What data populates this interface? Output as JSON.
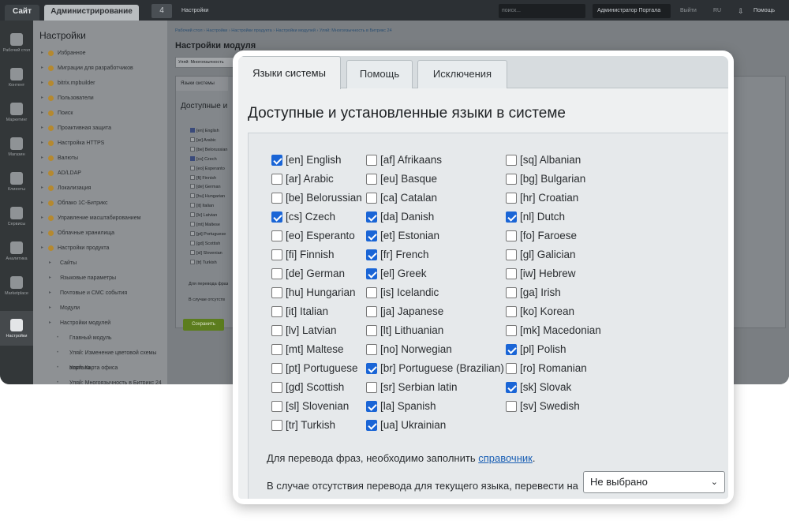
{
  "topbar": {
    "site": "Сайт",
    "admin": "Администрирование",
    "notifications": "4",
    "settings": "Настройки",
    "search_placeholder": "поиск...",
    "user": "Администратор Портала",
    "exit": "Выйти",
    "lang": "RU",
    "help": "Помощь"
  },
  "leftnav": [
    "Рабочий стол",
    "Контент",
    "Маркетинг",
    "Магазин",
    "Клиенты",
    "Сервисы",
    "Аналитика",
    "Marketplace",
    "Настройки"
  ],
  "tree": {
    "title": "Настройки",
    "items": [
      "Избранное",
      "Миграции для разработчиков",
      "bitrix.mpbuilder",
      "Пользователи",
      "Поиск",
      "Проактивная защита",
      "Настройка HTTPS",
      "Валюты",
      "AD/LDAP",
      "Локализация",
      "Облако 1С-Битрикс",
      "Управление масштабированием",
      "Облачные хранилища",
      "Настройки продукта",
      "Сайты",
      "Языковые параметры",
      "Почтовые и СМС события",
      "Модули",
      "Настройки модулей",
      "Главный модуль",
      "Уляй: Изменение цветовой схемы портала",
      "Уляй: Карта офиса",
      "Уляй: Многоязычность в Битрикс 24"
    ]
  },
  "content": {
    "breadcrumbs": "Рабочий стол  ›  Настройки  ›  Настройки продукта  ›  Настройки модулей  ›  Уляй: Многоязычность в Битрикс 24",
    "title": "Настройки модуля",
    "module_select": "Уляй: Многоязычность",
    "inner_tab": "Языки системы",
    "inner_head": "Доступные и",
    "note1": "Для перевода фраз",
    "note2": "В случае отсутств",
    "save": "Сохранить"
  },
  "card": {
    "tabs": [
      "Языки системы",
      "Помощь",
      "Исключения"
    ],
    "section_title": "Доступные и установленные языки в системе",
    "languages": [
      [
        {
          "label": "[en] English",
          "checked": true
        },
        {
          "label": "[ar] Arabic",
          "checked": false
        },
        {
          "label": "[be] Belorussian",
          "checked": false
        },
        {
          "label": "[cs] Czech",
          "checked": true
        },
        {
          "label": "[eo] Esperanto",
          "checked": false
        },
        {
          "label": "[fi] Finnish",
          "checked": false
        },
        {
          "label": "[de] German",
          "checked": false
        },
        {
          "label": "[hu] Hungarian",
          "checked": false
        },
        {
          "label": "[it] Italian",
          "checked": false
        },
        {
          "label": "[lv] Latvian",
          "checked": false
        },
        {
          "label": "[mt] Maltese",
          "checked": false
        },
        {
          "label": "[pt] Portuguese",
          "checked": false
        },
        {
          "label": "[gd] Scottish",
          "checked": false
        },
        {
          "label": "[sl] Slovenian",
          "checked": false
        },
        {
          "label": "[tr] Turkish",
          "checked": false
        }
      ],
      [
        {
          "label": "[af] Afrikaans",
          "checked": false
        },
        {
          "label": "[eu] Basque",
          "checked": false
        },
        {
          "label": "[ca] Catalan",
          "checked": false
        },
        {
          "label": "[da] Danish",
          "checked": true
        },
        {
          "label": "[et] Estonian",
          "checked": true
        },
        {
          "label": "[fr] French",
          "checked": true
        },
        {
          "label": "[el] Greek",
          "checked": true
        },
        {
          "label": "[is] Icelandic",
          "checked": false
        },
        {
          "label": "[ja] Japanese",
          "checked": false
        },
        {
          "label": "[lt] Lithuanian",
          "checked": false
        },
        {
          "label": "[no] Norwegian",
          "checked": false
        },
        {
          "label": "[br] Portuguese (Brazilian)",
          "checked": true
        },
        {
          "label": "[sr] Serbian latin",
          "checked": false
        },
        {
          "label": "[la] Spanish",
          "checked": true
        },
        {
          "label": "[ua] Ukrainian",
          "checked": true
        }
      ],
      [
        {
          "label": "[sq] Albanian",
          "checked": false
        },
        {
          "label": "[bg] Bulgarian",
          "checked": false
        },
        {
          "label": "[hr] Croatian",
          "checked": false
        },
        {
          "label": "[nl] Dutch",
          "checked": true
        },
        {
          "label": "[fo] Faroese",
          "checked": false
        },
        {
          "label": "[gl] Galician",
          "checked": false
        },
        {
          "label": "[iw] Hebrew",
          "checked": false
        },
        {
          "label": "[ga] Irish",
          "checked": false
        },
        {
          "label": "[ko] Korean",
          "checked": false
        },
        {
          "label": "[mk] Macedonian",
          "checked": false
        },
        {
          "label": "[pl] Polish",
          "checked": true
        },
        {
          "label": "[ro] Romanian",
          "checked": false
        },
        {
          "label": "[sk] Slovak",
          "checked": true
        },
        {
          "label": "[sv] Swedish",
          "checked": false
        }
      ]
    ],
    "note_prefix": "Для перевода фраз, необходимо заполнить ",
    "note_link": "справочник",
    "note_suffix": ".",
    "fallback_label": "В случае отсутствия перевода для текущего языка, перевести на",
    "fallback_value": "Не выбрано"
  }
}
